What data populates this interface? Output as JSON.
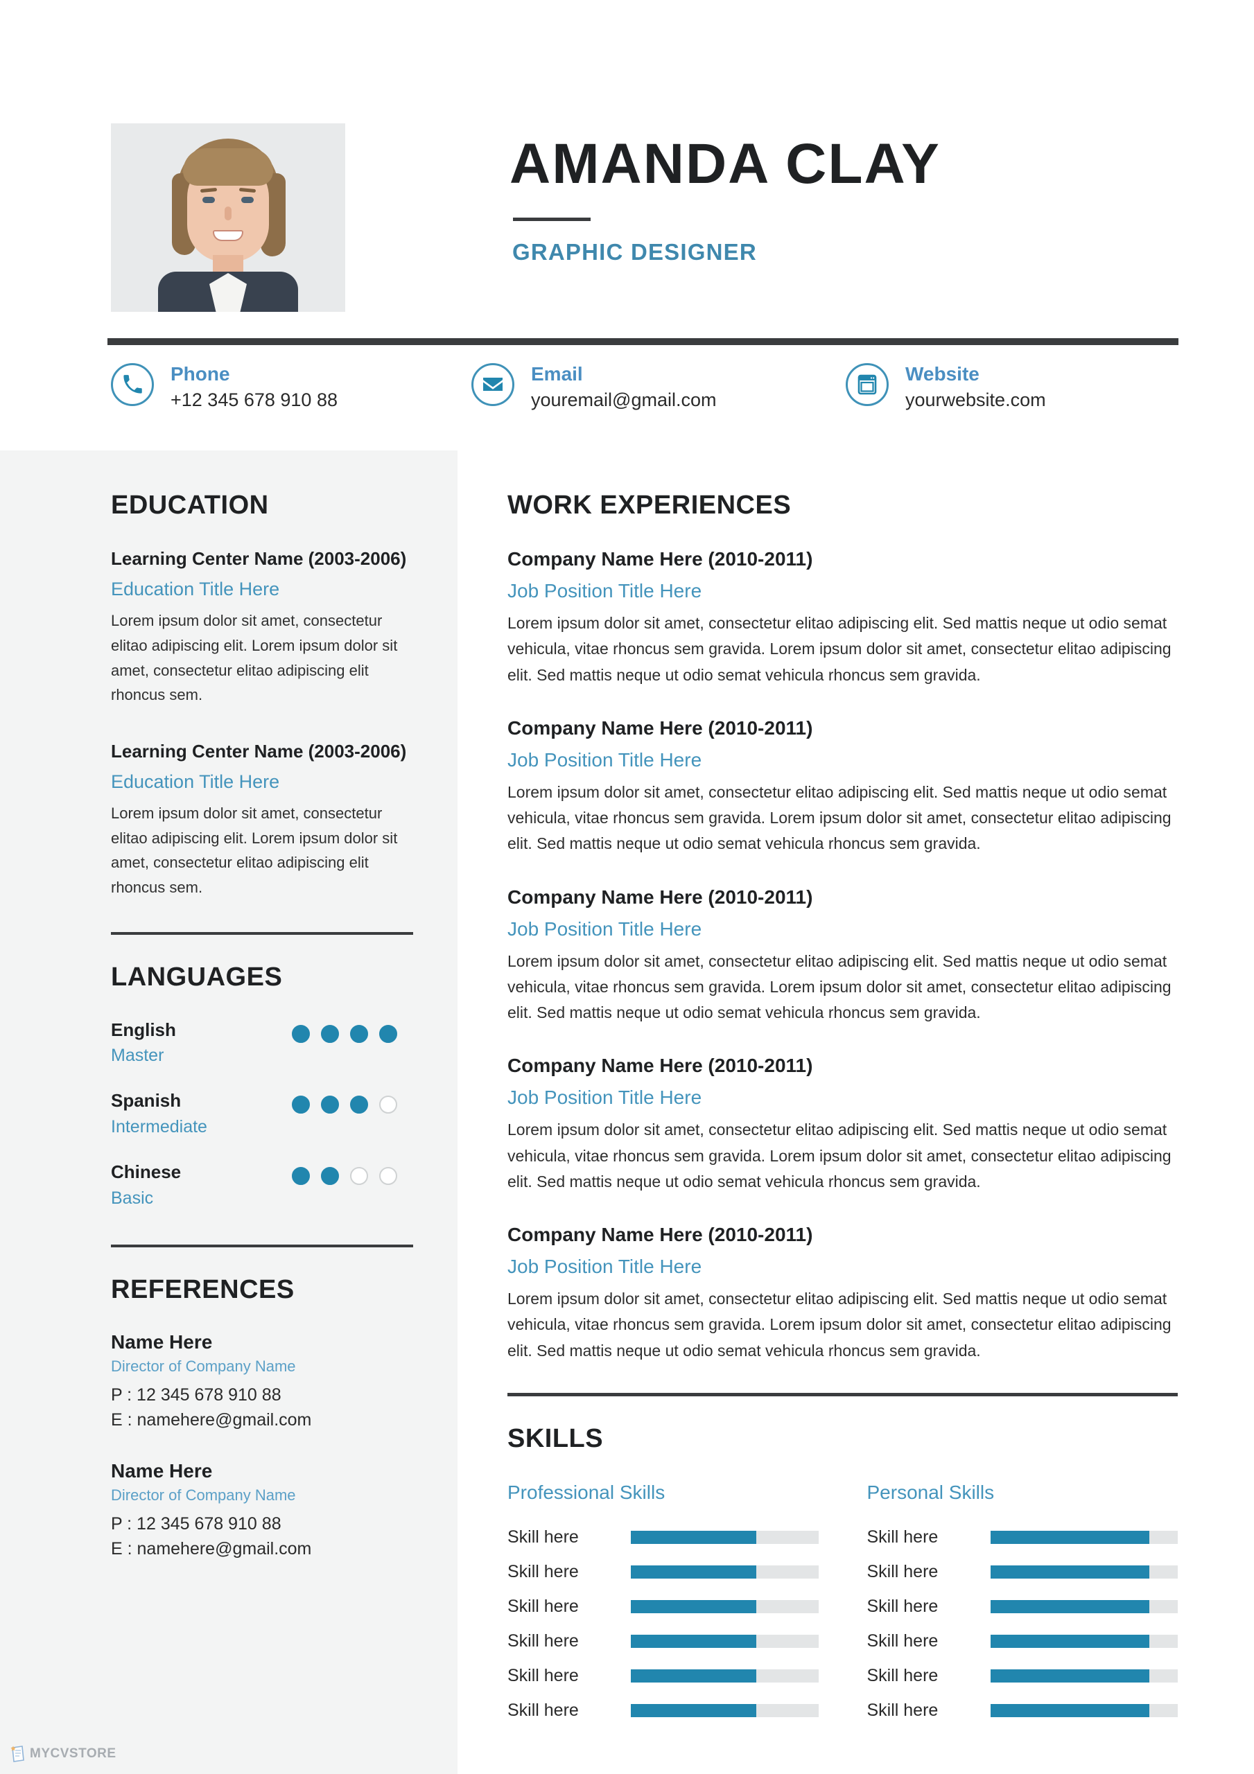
{
  "header": {
    "name": "AMANDA CLAY",
    "role": "GRAPHIC DESIGNER",
    "photo_alt": "profile-photo"
  },
  "contact": {
    "phone": {
      "label": "Phone",
      "value": "+12 345 678 910 88",
      "icon": "phone-icon"
    },
    "email": {
      "label": "Email",
      "value": "youremail@gmail.com",
      "icon": "envelope-icon"
    },
    "website": {
      "label": "Website",
      "value": "yourwebsite.com",
      "icon": "browser-window-icon"
    }
  },
  "education": {
    "title": "EDUCATION",
    "items": [
      {
        "school": "Learning Center Name (2003-2006)",
        "degree": "Education Title Here",
        "desc": "Lorem ipsum dolor sit amet, consectetur elitao adipiscing elit. Lorem ipsum dolor sit amet, consectetur elitao adipiscing elit rhoncus sem."
      },
      {
        "school": "Learning Center Name (2003-2006)",
        "degree": "Education Title Here",
        "desc": "Lorem ipsum dolor sit amet, consectetur elitao adipiscing elit. Lorem ipsum dolor sit amet, consectetur elitao adipiscing elit rhoncus sem."
      }
    ]
  },
  "languages": {
    "title": "LANGUAGES",
    "max_dots": 4,
    "items": [
      {
        "name": "English",
        "level": "Master",
        "rating": 4
      },
      {
        "name": "Spanish",
        "level": "Intermediate",
        "rating": 3
      },
      {
        "name": "Chinese",
        "level": "Basic",
        "rating": 2
      }
    ]
  },
  "references": {
    "title": "REFERENCES",
    "items": [
      {
        "name": "Name Here",
        "role": "Director of Company Name",
        "phone": "P : 12 345 678 910 88",
        "email": "E : namehere@gmail.com"
      },
      {
        "name": "Name Here",
        "role": "Director of Company Name",
        "phone": "P : 12 345 678 910 88",
        "email": "E : namehere@gmail.com"
      }
    ]
  },
  "work": {
    "title": "WORK EXPERIENCES",
    "items": [
      {
        "company": "Company Name Here (2010-2011)",
        "position": "Job Position Title Here",
        "desc": "Lorem ipsum dolor sit amet, consectetur elitao adipiscing elit. Sed mattis neque ut odio semat vehicula, vitae rhoncus sem gravida. Lorem ipsum dolor sit amet, consectetur elitao adipiscing elit. Sed mattis neque ut odio semat vehicula rhoncus sem gravida."
      },
      {
        "company": "Company Name Here (2010-2011)",
        "position": "Job Position Title Here",
        "desc": "Lorem ipsum dolor sit amet, consectetur elitao adipiscing elit. Sed mattis neque ut odio semat vehicula, vitae rhoncus sem gravida. Lorem ipsum dolor sit amet, consectetur elitao adipiscing elit. Sed mattis neque ut odio semat vehicula rhoncus sem gravida."
      },
      {
        "company": "Company Name Here (2010-2011)",
        "position": "Job Position Title Here",
        "desc": "Lorem ipsum dolor sit amet, consectetur elitao adipiscing elit. Sed mattis neque ut odio semat vehicula, vitae rhoncus sem gravida. Lorem ipsum dolor sit amet, consectetur elitao adipiscing elit. Sed mattis neque ut odio semat vehicula rhoncus sem gravida."
      },
      {
        "company": "Company Name Here (2010-2011)",
        "position": "Job Position Title Here",
        "desc": "Lorem ipsum dolor sit amet, consectetur elitao adipiscing elit. Sed mattis neque ut odio semat vehicula, vitae rhoncus sem gravida. Lorem ipsum dolor sit amet, consectetur elitao adipiscing elit. Sed mattis neque ut odio semat vehicula rhoncus sem gravida."
      },
      {
        "company": "Company Name Here (2010-2011)",
        "position": "Job Position Title Here",
        "desc": "Lorem ipsum dolor sit amet, consectetur elitao adipiscing elit. Sed mattis neque ut odio semat vehicula, vitae rhoncus sem gravida. Lorem ipsum dolor sit amet, consectetur elitao adipiscing elit. Sed mattis neque ut odio semat vehicula rhoncus sem gravida."
      }
    ]
  },
  "skills": {
    "title": "SKILLS",
    "columns": [
      {
        "title": "Professional Skills",
        "items": [
          {
            "label": "Skill here",
            "value": 67
          },
          {
            "label": "Skill here",
            "value": 67
          },
          {
            "label": "Skill here",
            "value": 67
          },
          {
            "label": "Skill here",
            "value": 67
          },
          {
            "label": "Skill here",
            "value": 67
          },
          {
            "label": "Skill here",
            "value": 67
          }
        ]
      },
      {
        "title": "Personal Skills",
        "items": [
          {
            "label": "Skill here",
            "value": 85
          },
          {
            "label": "Skill here",
            "value": 85
          },
          {
            "label": "Skill here",
            "value": 85
          },
          {
            "label": "Skill here",
            "value": 85
          },
          {
            "label": "Skill here",
            "value": 85
          },
          {
            "label": "Skill here",
            "value": 85
          }
        ]
      }
    ]
  },
  "watermark": {
    "text": "MYCVSTORE",
    "icon": "document-star-icon"
  },
  "colors": {
    "accent": "#2186ae",
    "accent_text": "#4494bc",
    "dark": "#1f2123",
    "sidebar_bg": "#f3f4f4",
    "track": "#e3e5e6"
  }
}
